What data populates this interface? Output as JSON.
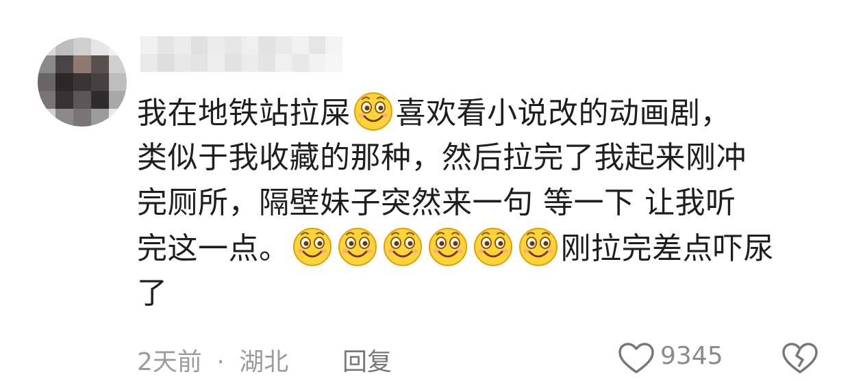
{
  "comment": {
    "lines": [
      {
        "parts": [
          {
            "type": "text",
            "value": "我在地铁站拉屎"
          },
          {
            "type": "emoji",
            "name": "smile-emoji"
          },
          {
            "type": "text",
            "value": "喜欢看小说改的动画剧，"
          }
        ]
      },
      {
        "parts": [
          {
            "type": "text",
            "value": "类似于我收藏的那种，然后拉完了我起来刚冲"
          }
        ]
      },
      {
        "parts": [
          {
            "type": "text",
            "value": "完厕所，隔壁妹子突然来一句 等一下 让我听"
          }
        ]
      },
      {
        "parts": [
          {
            "type": "text",
            "value": "完这一点。"
          },
          {
            "type": "emoji",
            "name": "smile-emoji"
          },
          {
            "type": "emoji",
            "name": "smile-emoji"
          },
          {
            "type": "emoji",
            "name": "smile-emoji"
          },
          {
            "type": "emoji",
            "name": "smile-emoji"
          },
          {
            "type": "emoji",
            "name": "smile-emoji"
          },
          {
            "type": "emoji",
            "name": "smile-emoji"
          },
          {
            "type": "text",
            "value": "刚拉完差点吓尿"
          }
        ]
      },
      {
        "parts": [
          {
            "type": "text",
            "value": "了"
          }
        ]
      }
    ]
  },
  "footer": {
    "time": "2天前",
    "separator": "·",
    "location": "湖北",
    "reply_label": "回复",
    "like_count": "9345"
  },
  "icons": {
    "like": "heart-outline-icon",
    "dislike": "broken-heart-icon",
    "emoji": "smile-emoji"
  },
  "colors": {
    "text": "#1e1e1e",
    "meta": "#9b9b9b",
    "emoji_face": "#ffd43b",
    "emoji_outline": "#e0a100"
  }
}
